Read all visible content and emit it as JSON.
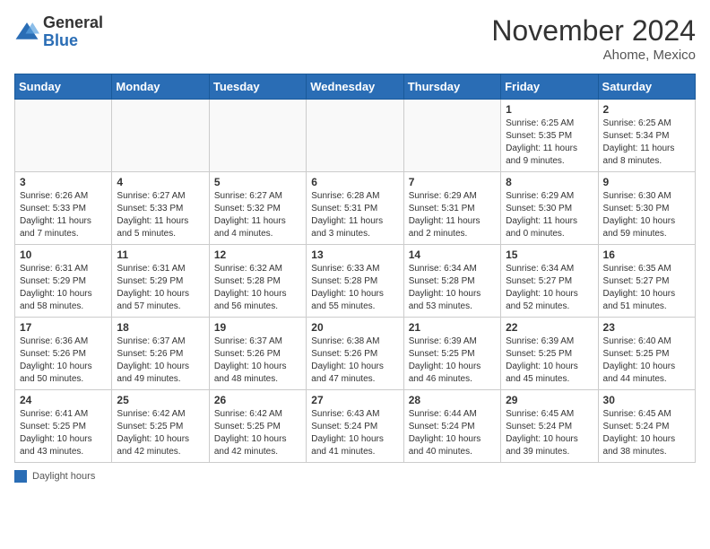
{
  "header": {
    "logo": {
      "general": "General",
      "blue": "Blue"
    },
    "title": "November 2024",
    "location": "Ahome, Mexico"
  },
  "days_of_week": [
    "Sunday",
    "Monday",
    "Tuesday",
    "Wednesday",
    "Thursday",
    "Friday",
    "Saturday"
  ],
  "legend": {
    "label": "Daylight hours"
  },
  "weeks": [
    {
      "days": [
        {
          "num": "",
          "info": "",
          "empty": true
        },
        {
          "num": "",
          "info": "",
          "empty": true
        },
        {
          "num": "",
          "info": "",
          "empty": true
        },
        {
          "num": "",
          "info": "",
          "empty": true
        },
        {
          "num": "",
          "info": "",
          "empty": true
        },
        {
          "num": "1",
          "info": "Sunrise: 6:25 AM\nSunset: 5:35 PM\nDaylight: 11 hours\nand 9 minutes.",
          "empty": false
        },
        {
          "num": "2",
          "info": "Sunrise: 6:25 AM\nSunset: 5:34 PM\nDaylight: 11 hours\nand 8 minutes.",
          "empty": false
        }
      ]
    },
    {
      "days": [
        {
          "num": "3",
          "info": "Sunrise: 6:26 AM\nSunset: 5:33 PM\nDaylight: 11 hours\nand 7 minutes.",
          "empty": false
        },
        {
          "num": "4",
          "info": "Sunrise: 6:27 AM\nSunset: 5:33 PM\nDaylight: 11 hours\nand 5 minutes.",
          "empty": false
        },
        {
          "num": "5",
          "info": "Sunrise: 6:27 AM\nSunset: 5:32 PM\nDaylight: 11 hours\nand 4 minutes.",
          "empty": false
        },
        {
          "num": "6",
          "info": "Sunrise: 6:28 AM\nSunset: 5:31 PM\nDaylight: 11 hours\nand 3 minutes.",
          "empty": false
        },
        {
          "num": "7",
          "info": "Sunrise: 6:29 AM\nSunset: 5:31 PM\nDaylight: 11 hours\nand 2 minutes.",
          "empty": false
        },
        {
          "num": "8",
          "info": "Sunrise: 6:29 AM\nSunset: 5:30 PM\nDaylight: 11 hours\nand 0 minutes.",
          "empty": false
        },
        {
          "num": "9",
          "info": "Sunrise: 6:30 AM\nSunset: 5:30 PM\nDaylight: 10 hours\nand 59 minutes.",
          "empty": false
        }
      ]
    },
    {
      "days": [
        {
          "num": "10",
          "info": "Sunrise: 6:31 AM\nSunset: 5:29 PM\nDaylight: 10 hours\nand 58 minutes.",
          "empty": false
        },
        {
          "num": "11",
          "info": "Sunrise: 6:31 AM\nSunset: 5:29 PM\nDaylight: 10 hours\nand 57 minutes.",
          "empty": false
        },
        {
          "num": "12",
          "info": "Sunrise: 6:32 AM\nSunset: 5:28 PM\nDaylight: 10 hours\nand 56 minutes.",
          "empty": false
        },
        {
          "num": "13",
          "info": "Sunrise: 6:33 AM\nSunset: 5:28 PM\nDaylight: 10 hours\nand 55 minutes.",
          "empty": false
        },
        {
          "num": "14",
          "info": "Sunrise: 6:34 AM\nSunset: 5:28 PM\nDaylight: 10 hours\nand 53 minutes.",
          "empty": false
        },
        {
          "num": "15",
          "info": "Sunrise: 6:34 AM\nSunset: 5:27 PM\nDaylight: 10 hours\nand 52 minutes.",
          "empty": false
        },
        {
          "num": "16",
          "info": "Sunrise: 6:35 AM\nSunset: 5:27 PM\nDaylight: 10 hours\nand 51 minutes.",
          "empty": false
        }
      ]
    },
    {
      "days": [
        {
          "num": "17",
          "info": "Sunrise: 6:36 AM\nSunset: 5:26 PM\nDaylight: 10 hours\nand 50 minutes.",
          "empty": false
        },
        {
          "num": "18",
          "info": "Sunrise: 6:37 AM\nSunset: 5:26 PM\nDaylight: 10 hours\nand 49 minutes.",
          "empty": false
        },
        {
          "num": "19",
          "info": "Sunrise: 6:37 AM\nSunset: 5:26 PM\nDaylight: 10 hours\nand 48 minutes.",
          "empty": false
        },
        {
          "num": "20",
          "info": "Sunrise: 6:38 AM\nSunset: 5:26 PM\nDaylight: 10 hours\nand 47 minutes.",
          "empty": false
        },
        {
          "num": "21",
          "info": "Sunrise: 6:39 AM\nSunset: 5:25 PM\nDaylight: 10 hours\nand 46 minutes.",
          "empty": false
        },
        {
          "num": "22",
          "info": "Sunrise: 6:39 AM\nSunset: 5:25 PM\nDaylight: 10 hours\nand 45 minutes.",
          "empty": false
        },
        {
          "num": "23",
          "info": "Sunrise: 6:40 AM\nSunset: 5:25 PM\nDaylight: 10 hours\nand 44 minutes.",
          "empty": false
        }
      ]
    },
    {
      "days": [
        {
          "num": "24",
          "info": "Sunrise: 6:41 AM\nSunset: 5:25 PM\nDaylight: 10 hours\nand 43 minutes.",
          "empty": false
        },
        {
          "num": "25",
          "info": "Sunrise: 6:42 AM\nSunset: 5:25 PM\nDaylight: 10 hours\nand 42 minutes.",
          "empty": false
        },
        {
          "num": "26",
          "info": "Sunrise: 6:42 AM\nSunset: 5:25 PM\nDaylight: 10 hours\nand 42 minutes.",
          "empty": false
        },
        {
          "num": "27",
          "info": "Sunrise: 6:43 AM\nSunset: 5:24 PM\nDaylight: 10 hours\nand 41 minutes.",
          "empty": false
        },
        {
          "num": "28",
          "info": "Sunrise: 6:44 AM\nSunset: 5:24 PM\nDaylight: 10 hours\nand 40 minutes.",
          "empty": false
        },
        {
          "num": "29",
          "info": "Sunrise: 6:45 AM\nSunset: 5:24 PM\nDaylight: 10 hours\nand 39 minutes.",
          "empty": false
        },
        {
          "num": "30",
          "info": "Sunrise: 6:45 AM\nSunset: 5:24 PM\nDaylight: 10 hours\nand 38 minutes.",
          "empty": false
        }
      ]
    }
  ]
}
